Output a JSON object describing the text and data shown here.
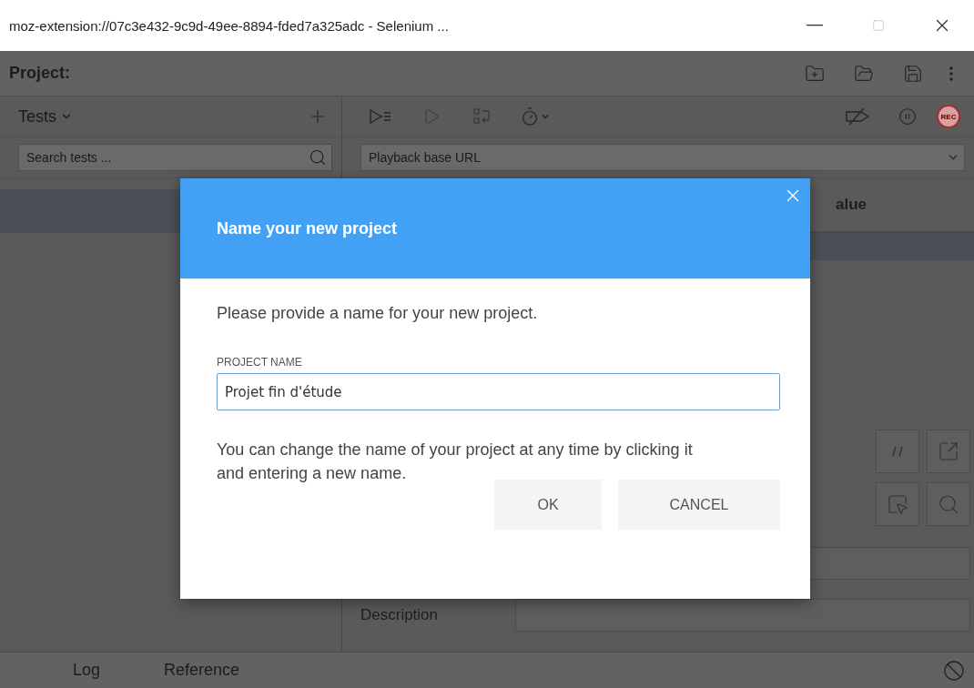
{
  "window": {
    "title": "moz-extension://07c3e432-9c9d-49ee-8894-fded7a325adc - Selenium ..."
  },
  "project": {
    "label": "Project:"
  },
  "tests_panel": {
    "title": "Tests",
    "search": {
      "placeholder": "Search tests ..."
    },
    "rows": [
      {
        "selected": true
      }
    ]
  },
  "toolbar": {
    "record_label": "REC"
  },
  "editor": {
    "base_url": {
      "placeholder": "Playback base URL"
    },
    "columns": [
      "alue"
    ],
    "rows": [
      {
        "selected": true
      }
    ],
    "command_fields": [
      {
        "kind": "plain"
      },
      {
        "kind": "labeled",
        "label": "Description"
      }
    ]
  },
  "bottom_tabs": [
    {
      "label": "Log"
    },
    {
      "label": "Reference"
    }
  ],
  "dialog": {
    "title": "Name your new project",
    "intro": "Please provide a name for your new project.",
    "field_label": "PROJECT NAME",
    "field_value": "Projet fin d'étude",
    "note": "You can change the name of your project at any time by clicking it and entering a new name.",
    "buttons": [
      "OK",
      "CANCEL"
    ]
  }
}
